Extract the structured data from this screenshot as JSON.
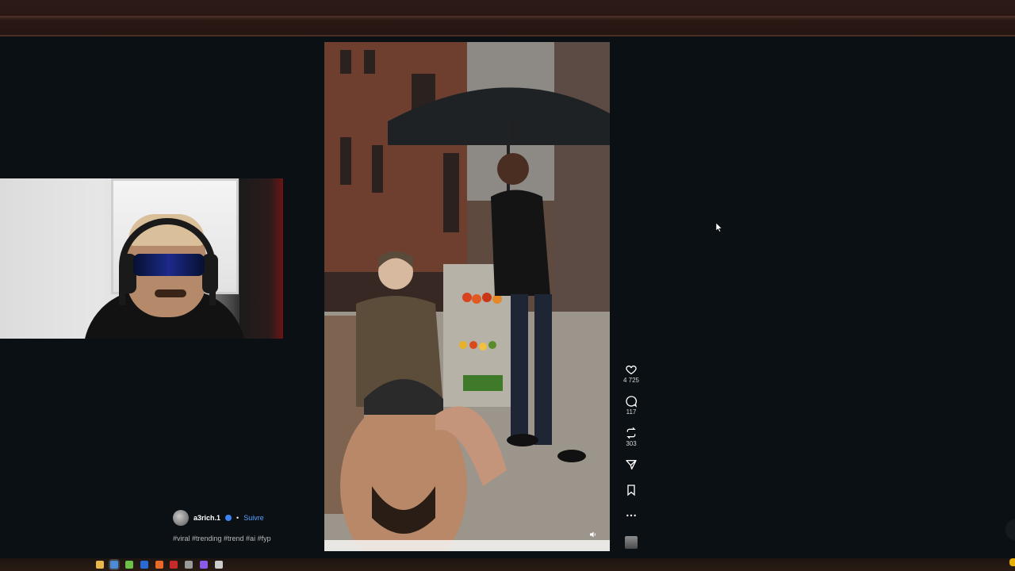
{
  "post": {
    "author": "a3rich.1",
    "follow_label": "Suivre",
    "separator": "•",
    "hashtags": "#viral #trending #trend #ai #fyp"
  },
  "actions": {
    "likes": "4 725",
    "comments": "117",
    "reposts": "303"
  },
  "icons": {
    "like": "heart-icon",
    "comment": "comment-icon",
    "repost": "repost-icon",
    "share": "share-icon",
    "save": "bookmark-icon",
    "more": "more-icon",
    "mute": "speaker-icon"
  },
  "colors": {
    "background": "#0b1014",
    "follow": "#5aa0ff",
    "verified": "#3b82f6"
  }
}
